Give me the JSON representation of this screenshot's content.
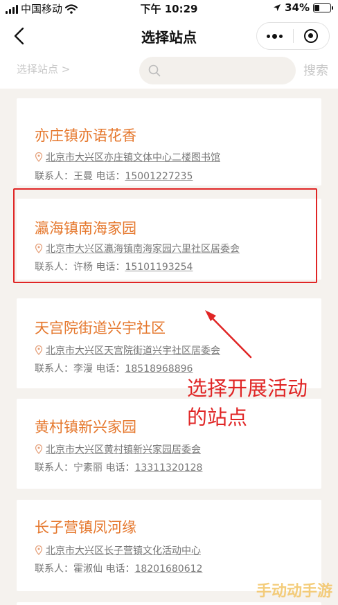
{
  "status_bar": {
    "carrier": "中国移动",
    "time": "下午 10:29",
    "battery": "34%",
    "battery_level": 0.34
  },
  "nav": {
    "title": "选择站点"
  },
  "search": {
    "breadcrumb": "选择站点 >",
    "placeholder": "",
    "button_label": "搜索"
  },
  "sites": [
    {
      "name": "亦庄镇亦语花香",
      "address": "北京市大兴区亦庄镇文体中心二楼图书馆",
      "contact_label": "联系人：",
      "contact_name": "王曼",
      "phone_label": "电话：",
      "phone": "15001227235"
    },
    {
      "name": "瀛海镇南海家园",
      "address": "北京市大兴区瀛海镇南海家园六里社区居委会",
      "contact_label": "联系人：",
      "contact_name": "许杨",
      "phone_label": "电话：",
      "phone": "15101193254"
    },
    {
      "name": "天宫院街道兴宇社区",
      "address": "北京市大兴区天宫院街道兴宇社区居委会",
      "contact_label": "联系人：",
      "contact_name": "李漫",
      "phone_label": "电话：",
      "phone": "18518968896"
    },
    {
      "name": "黄村镇新兴家园",
      "address": "北京市大兴区黄村镇新兴家园居委会",
      "contact_label": "联系人：",
      "contact_name": "宁素丽",
      "phone_label": "电话：",
      "phone": "13311320128"
    },
    {
      "name": "长子营镇凤河缘",
      "address": "北京市大兴区长子营镇文化活动中心",
      "contact_label": "联系人：",
      "contact_name": "霍淑仙",
      "phone_label": "电话：",
      "phone": "18201680612"
    }
  ],
  "annotation": {
    "text": "选择开展活动\n的站点"
  },
  "watermark": "手动动手游",
  "colors": {
    "accent": "#e5772c",
    "annotation": "#e02525",
    "background": "#f5f2ee"
  }
}
